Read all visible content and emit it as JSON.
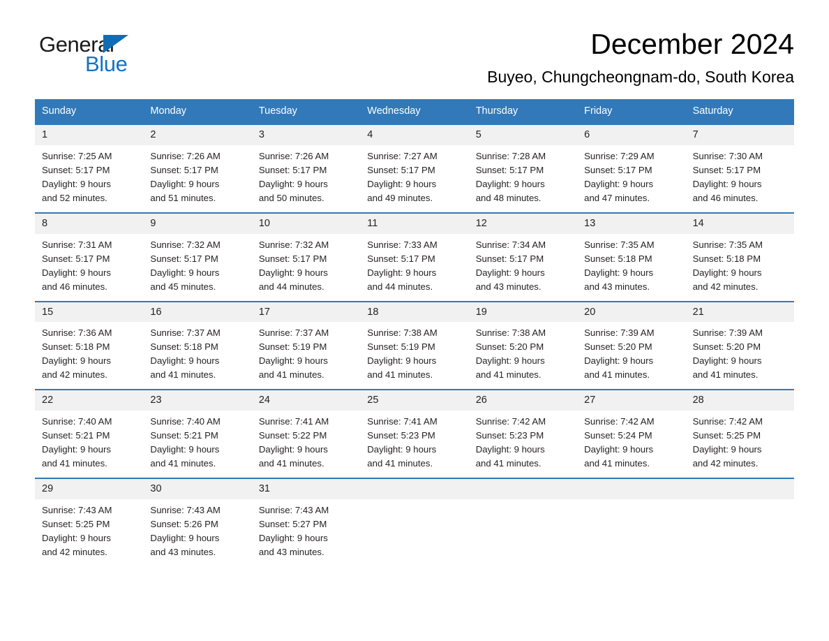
{
  "logo": {
    "word_one": "General",
    "word_two": "Blue",
    "triangle_color": "#0f6cb5",
    "blue_text_color": "#1273c4"
  },
  "header": {
    "title": "December 2024",
    "subtitle": "Buyeo, Chungcheongnam-do, South Korea"
  },
  "colors": {
    "header_blue": "#3179b9",
    "daynum_strip": "#f1f1f1",
    "text": "#231f20",
    "page_background": "#ffffff"
  },
  "calendar": {
    "weekdays": [
      "Sunday",
      "Monday",
      "Tuesday",
      "Wednesday",
      "Thursday",
      "Friday",
      "Saturday"
    ],
    "weeks": [
      {
        "days": [
          {
            "num": "1",
            "sunrise": "Sunrise: 7:25 AM",
            "sunset": "Sunset: 5:17 PM",
            "daylight_line1": "Daylight: 9 hours",
            "daylight_line2": "and 52 minutes."
          },
          {
            "num": "2",
            "sunrise": "Sunrise: 7:26 AM",
            "sunset": "Sunset: 5:17 PM",
            "daylight_line1": "Daylight: 9 hours",
            "daylight_line2": "and 51 minutes."
          },
          {
            "num": "3",
            "sunrise": "Sunrise: 7:26 AM",
            "sunset": "Sunset: 5:17 PM",
            "daylight_line1": "Daylight: 9 hours",
            "daylight_line2": "and 50 minutes."
          },
          {
            "num": "4",
            "sunrise": "Sunrise: 7:27 AM",
            "sunset": "Sunset: 5:17 PM",
            "daylight_line1": "Daylight: 9 hours",
            "daylight_line2": "and 49 minutes."
          },
          {
            "num": "5",
            "sunrise": "Sunrise: 7:28 AM",
            "sunset": "Sunset: 5:17 PM",
            "daylight_line1": "Daylight: 9 hours",
            "daylight_line2": "and 48 minutes."
          },
          {
            "num": "6",
            "sunrise": "Sunrise: 7:29 AM",
            "sunset": "Sunset: 5:17 PM",
            "daylight_line1": "Daylight: 9 hours",
            "daylight_line2": "and 47 minutes."
          },
          {
            "num": "7",
            "sunrise": "Sunrise: 7:30 AM",
            "sunset": "Sunset: 5:17 PM",
            "daylight_line1": "Daylight: 9 hours",
            "daylight_line2": "and 46 minutes."
          }
        ]
      },
      {
        "days": [
          {
            "num": "8",
            "sunrise": "Sunrise: 7:31 AM",
            "sunset": "Sunset: 5:17 PM",
            "daylight_line1": "Daylight: 9 hours",
            "daylight_line2": "and 46 minutes."
          },
          {
            "num": "9",
            "sunrise": "Sunrise: 7:32 AM",
            "sunset": "Sunset: 5:17 PM",
            "daylight_line1": "Daylight: 9 hours",
            "daylight_line2": "and 45 minutes."
          },
          {
            "num": "10",
            "sunrise": "Sunrise: 7:32 AM",
            "sunset": "Sunset: 5:17 PM",
            "daylight_line1": "Daylight: 9 hours",
            "daylight_line2": "and 44 minutes."
          },
          {
            "num": "11",
            "sunrise": "Sunrise: 7:33 AM",
            "sunset": "Sunset: 5:17 PM",
            "daylight_line1": "Daylight: 9 hours",
            "daylight_line2": "and 44 minutes."
          },
          {
            "num": "12",
            "sunrise": "Sunrise: 7:34 AM",
            "sunset": "Sunset: 5:17 PM",
            "daylight_line1": "Daylight: 9 hours",
            "daylight_line2": "and 43 minutes."
          },
          {
            "num": "13",
            "sunrise": "Sunrise: 7:35 AM",
            "sunset": "Sunset: 5:18 PM",
            "daylight_line1": "Daylight: 9 hours",
            "daylight_line2": "and 43 minutes."
          },
          {
            "num": "14",
            "sunrise": "Sunrise: 7:35 AM",
            "sunset": "Sunset: 5:18 PM",
            "daylight_line1": "Daylight: 9 hours",
            "daylight_line2": "and 42 minutes."
          }
        ]
      },
      {
        "days": [
          {
            "num": "15",
            "sunrise": "Sunrise: 7:36 AM",
            "sunset": "Sunset: 5:18 PM",
            "daylight_line1": "Daylight: 9 hours",
            "daylight_line2": "and 42 minutes."
          },
          {
            "num": "16",
            "sunrise": "Sunrise: 7:37 AM",
            "sunset": "Sunset: 5:18 PM",
            "daylight_line1": "Daylight: 9 hours",
            "daylight_line2": "and 41 minutes."
          },
          {
            "num": "17",
            "sunrise": "Sunrise: 7:37 AM",
            "sunset": "Sunset: 5:19 PM",
            "daylight_line1": "Daylight: 9 hours",
            "daylight_line2": "and 41 minutes."
          },
          {
            "num": "18",
            "sunrise": "Sunrise: 7:38 AM",
            "sunset": "Sunset: 5:19 PM",
            "daylight_line1": "Daylight: 9 hours",
            "daylight_line2": "and 41 minutes."
          },
          {
            "num": "19",
            "sunrise": "Sunrise: 7:38 AM",
            "sunset": "Sunset: 5:20 PM",
            "daylight_line1": "Daylight: 9 hours",
            "daylight_line2": "and 41 minutes."
          },
          {
            "num": "20",
            "sunrise": "Sunrise: 7:39 AM",
            "sunset": "Sunset: 5:20 PM",
            "daylight_line1": "Daylight: 9 hours",
            "daylight_line2": "and 41 minutes."
          },
          {
            "num": "21",
            "sunrise": "Sunrise: 7:39 AM",
            "sunset": "Sunset: 5:20 PM",
            "daylight_line1": "Daylight: 9 hours",
            "daylight_line2": "and 41 minutes."
          }
        ]
      },
      {
        "days": [
          {
            "num": "22",
            "sunrise": "Sunrise: 7:40 AM",
            "sunset": "Sunset: 5:21 PM",
            "daylight_line1": "Daylight: 9 hours",
            "daylight_line2": "and 41 minutes."
          },
          {
            "num": "23",
            "sunrise": "Sunrise: 7:40 AM",
            "sunset": "Sunset: 5:21 PM",
            "daylight_line1": "Daylight: 9 hours",
            "daylight_line2": "and 41 minutes."
          },
          {
            "num": "24",
            "sunrise": "Sunrise: 7:41 AM",
            "sunset": "Sunset: 5:22 PM",
            "daylight_line1": "Daylight: 9 hours",
            "daylight_line2": "and 41 minutes."
          },
          {
            "num": "25",
            "sunrise": "Sunrise: 7:41 AM",
            "sunset": "Sunset: 5:23 PM",
            "daylight_line1": "Daylight: 9 hours",
            "daylight_line2": "and 41 minutes."
          },
          {
            "num": "26",
            "sunrise": "Sunrise: 7:42 AM",
            "sunset": "Sunset: 5:23 PM",
            "daylight_line1": "Daylight: 9 hours",
            "daylight_line2": "and 41 minutes."
          },
          {
            "num": "27",
            "sunrise": "Sunrise: 7:42 AM",
            "sunset": "Sunset: 5:24 PM",
            "daylight_line1": "Daylight: 9 hours",
            "daylight_line2": "and 41 minutes."
          },
          {
            "num": "28",
            "sunrise": "Sunrise: 7:42 AM",
            "sunset": "Sunset: 5:25 PM",
            "daylight_line1": "Daylight: 9 hours",
            "daylight_line2": "and 42 minutes."
          }
        ]
      },
      {
        "days": [
          {
            "num": "29",
            "sunrise": "Sunrise: 7:43 AM",
            "sunset": "Sunset: 5:25 PM",
            "daylight_line1": "Daylight: 9 hours",
            "daylight_line2": "and 42 minutes."
          },
          {
            "num": "30",
            "sunrise": "Sunrise: 7:43 AM",
            "sunset": "Sunset: 5:26 PM",
            "daylight_line1": "Daylight: 9 hours",
            "daylight_line2": "and 43 minutes."
          },
          {
            "num": "31",
            "sunrise": "Sunrise: 7:43 AM",
            "sunset": "Sunset: 5:27 PM",
            "daylight_line1": "Daylight: 9 hours",
            "daylight_line2": "and 43 minutes."
          },
          {
            "num": "",
            "sunrise": "",
            "sunset": "",
            "daylight_line1": "",
            "daylight_line2": ""
          },
          {
            "num": "",
            "sunrise": "",
            "sunset": "",
            "daylight_line1": "",
            "daylight_line2": ""
          },
          {
            "num": "",
            "sunrise": "",
            "sunset": "",
            "daylight_line1": "",
            "daylight_line2": ""
          },
          {
            "num": "",
            "sunrise": "",
            "sunset": "",
            "daylight_line1": "",
            "daylight_line2": ""
          }
        ]
      }
    ]
  }
}
